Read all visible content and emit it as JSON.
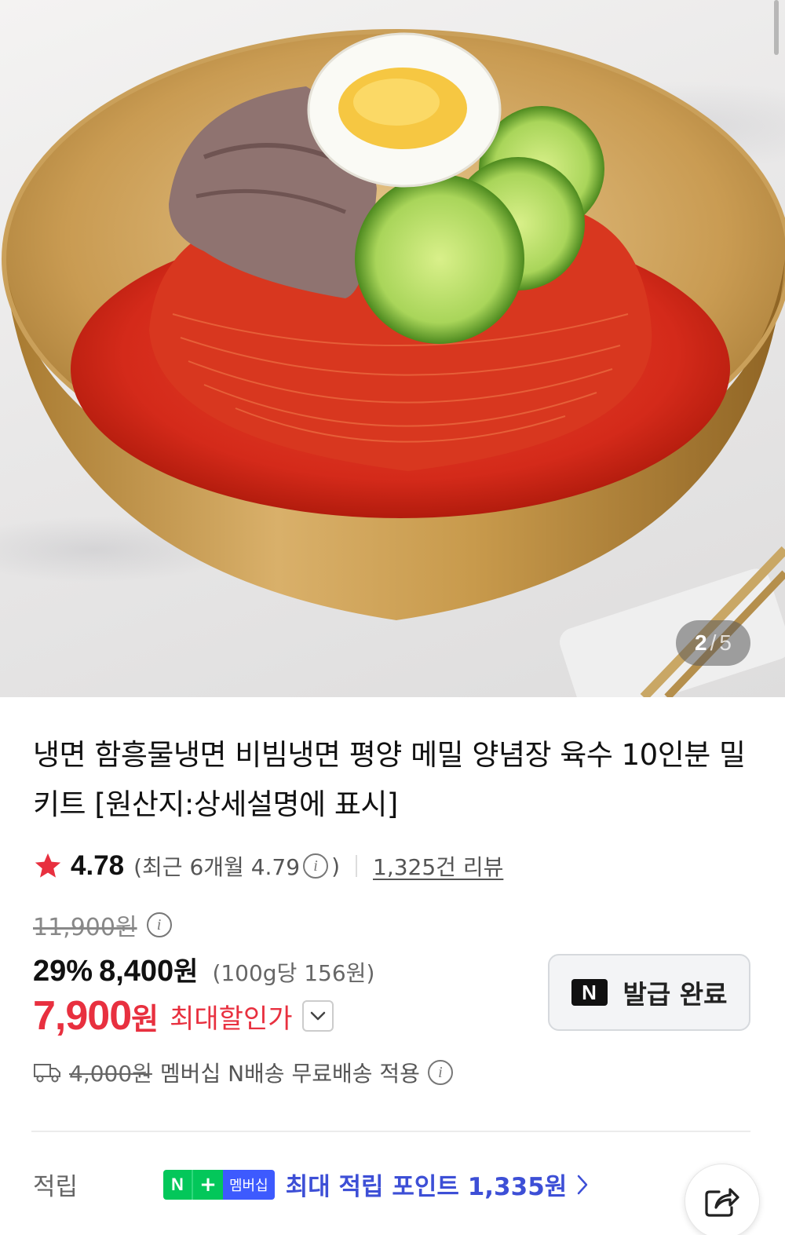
{
  "image": {
    "description_icon": "product-photo",
    "page_current": "2",
    "page_separator": "/",
    "page_total": "5"
  },
  "product": {
    "title": "냉면 함흥물냉면 비빔냉면 평양 메밀 양념장 육수 10인분 밀키트 [원산지:상세설명에 표시]"
  },
  "rating": {
    "score": "4.78",
    "recent_prefix": "(최근 6개월 4.79",
    "recent_suffix": ")",
    "reviews": "1,325건 리뷰"
  },
  "price": {
    "original": "11,900원",
    "discount_rate": "29%",
    "sale_price": "8,400",
    "sale_unit": "원",
    "unit_price": "(100g당 156원)",
    "max_price": "7,900",
    "max_unit": "원",
    "max_label": "최대할인가"
  },
  "coupon": {
    "badge": "N",
    "label": "발급 완료"
  },
  "shipping": {
    "original_fee": "4,000원",
    "text": "멤버십 N배송 무료배송 적용"
  },
  "points": {
    "label": "적립",
    "badge_n": "N",
    "badge_plus": "+",
    "badge_membership": "멤버십",
    "text": "최대 적립 포인트 1,335원"
  },
  "colors": {
    "accent_red": "#e8303f",
    "points_blue": "#3d4fd6",
    "naver_green": "#03c75a"
  }
}
